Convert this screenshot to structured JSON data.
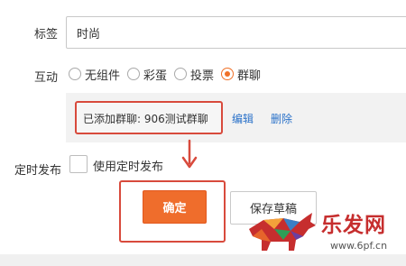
{
  "form": {
    "tags_label": "标签",
    "tags_value": "时尚",
    "interact_label": "互动",
    "interact_options": [
      {
        "label": "无组件",
        "checked": false
      },
      {
        "label": "彩蛋",
        "checked": false
      },
      {
        "label": "投票",
        "checked": false
      },
      {
        "label": "群聊",
        "checked": true
      }
    ],
    "group_added_text": "已添加群聊: 906测试群聊",
    "edit_link": "编辑",
    "delete_link": "删除",
    "schedule_label": "定时发布",
    "schedule_checkbox_label": "使用定时发布",
    "confirm_button": "确定",
    "draft_button": "保存草稿"
  },
  "watermark": {
    "title": "乐发网",
    "url": "www.6pf.cn"
  },
  "colors": {
    "accent": "#ef6d2c",
    "highlight_border": "#d84a3c",
    "link": "#2b72c9"
  },
  "icons": {
    "arrow": "arrow-down-icon",
    "watermark_logo": "bull-logo-icon"
  }
}
